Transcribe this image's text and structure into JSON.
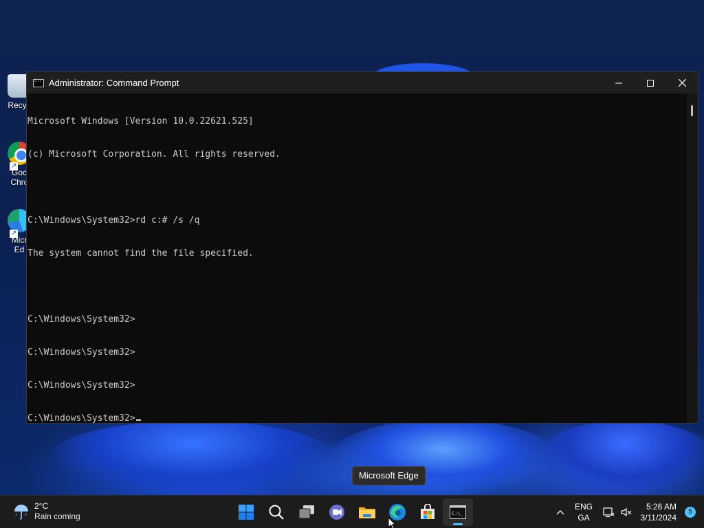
{
  "desktop": {
    "icons": [
      {
        "label": "Recyc"
      },
      {
        "label": "Goc\nChrc"
      },
      {
        "label": "Micr\nEd"
      }
    ]
  },
  "window": {
    "title": "Administrator: Command Prompt",
    "controls": {
      "minimize": "minimize-icon",
      "maximize": "maximize-icon",
      "close": "close-icon"
    },
    "console_lines": [
      "Microsoft Windows [Version 10.0.22621.525]",
      "(c) Microsoft Corporation. All rights reserved.",
      "",
      "C:\\Windows\\System32>rd c:# /s /q",
      "The system cannot find the file specified.",
      "",
      "C:\\Windows\\System32>",
      "C:\\Windows\\System32>",
      "C:\\Windows\\System32>",
      "C:\\Windows\\System32>"
    ]
  },
  "tooltip": {
    "text": "Microsoft Edge"
  },
  "taskbar": {
    "weather": {
      "temp": "2°C",
      "desc": "Rain coming"
    },
    "apps": [
      "start-icon",
      "search-icon",
      "task-view-icon",
      "teams-chat-icon",
      "file-explorer-icon",
      "edge-icon",
      "store-icon",
      "command-prompt-icon"
    ],
    "tray": {
      "lang_line1": "ENG",
      "lang_line2": "GA",
      "time": "5:26 AM",
      "date": "3/11/2024",
      "notification_count": "5"
    }
  },
  "colors": {
    "console_bg": "#0c0c0c",
    "console_fg": "#cccccc",
    "titlebar": "#1f1f1f",
    "taskbar": "#1c1c1c",
    "accent": "#4cc2ff"
  }
}
